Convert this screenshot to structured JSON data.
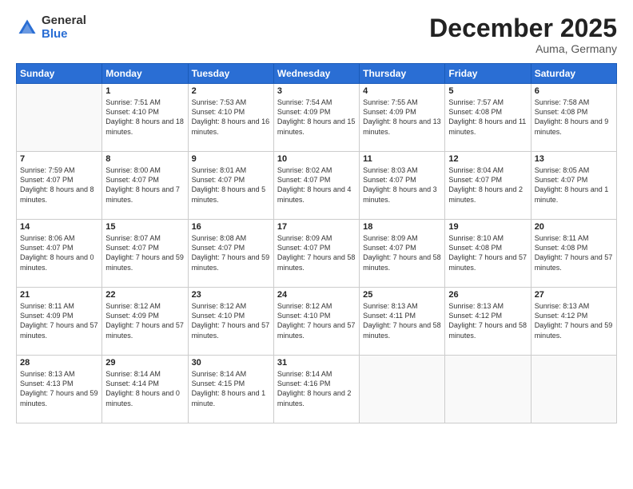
{
  "header": {
    "logo_general": "General",
    "logo_blue": "Blue",
    "month_title": "December 2025",
    "location": "Auma, Germany"
  },
  "days_of_week": [
    "Sunday",
    "Monday",
    "Tuesday",
    "Wednesday",
    "Thursday",
    "Friday",
    "Saturday"
  ],
  "weeks": [
    [
      {
        "day": "",
        "sunrise": "",
        "sunset": "",
        "daylight": "",
        "empty": true
      },
      {
        "day": "1",
        "sunrise": "Sunrise: 7:51 AM",
        "sunset": "Sunset: 4:10 PM",
        "daylight": "Daylight: 8 hours and 18 minutes."
      },
      {
        "day": "2",
        "sunrise": "Sunrise: 7:53 AM",
        "sunset": "Sunset: 4:10 PM",
        "daylight": "Daylight: 8 hours and 16 minutes."
      },
      {
        "day": "3",
        "sunrise": "Sunrise: 7:54 AM",
        "sunset": "Sunset: 4:09 PM",
        "daylight": "Daylight: 8 hours and 15 minutes."
      },
      {
        "day": "4",
        "sunrise": "Sunrise: 7:55 AM",
        "sunset": "Sunset: 4:09 PM",
        "daylight": "Daylight: 8 hours and 13 minutes."
      },
      {
        "day": "5",
        "sunrise": "Sunrise: 7:57 AM",
        "sunset": "Sunset: 4:08 PM",
        "daylight": "Daylight: 8 hours and 11 minutes."
      },
      {
        "day": "6",
        "sunrise": "Sunrise: 7:58 AM",
        "sunset": "Sunset: 4:08 PM",
        "daylight": "Daylight: 8 hours and 9 minutes."
      }
    ],
    [
      {
        "day": "7",
        "sunrise": "Sunrise: 7:59 AM",
        "sunset": "Sunset: 4:07 PM",
        "daylight": "Daylight: 8 hours and 8 minutes."
      },
      {
        "day": "8",
        "sunrise": "Sunrise: 8:00 AM",
        "sunset": "Sunset: 4:07 PM",
        "daylight": "Daylight: 8 hours and 7 minutes."
      },
      {
        "day": "9",
        "sunrise": "Sunrise: 8:01 AM",
        "sunset": "Sunset: 4:07 PM",
        "daylight": "Daylight: 8 hours and 5 minutes."
      },
      {
        "day": "10",
        "sunrise": "Sunrise: 8:02 AM",
        "sunset": "Sunset: 4:07 PM",
        "daylight": "Daylight: 8 hours and 4 minutes."
      },
      {
        "day": "11",
        "sunrise": "Sunrise: 8:03 AM",
        "sunset": "Sunset: 4:07 PM",
        "daylight": "Daylight: 8 hours and 3 minutes."
      },
      {
        "day": "12",
        "sunrise": "Sunrise: 8:04 AM",
        "sunset": "Sunset: 4:07 PM",
        "daylight": "Daylight: 8 hours and 2 minutes."
      },
      {
        "day": "13",
        "sunrise": "Sunrise: 8:05 AM",
        "sunset": "Sunset: 4:07 PM",
        "daylight": "Daylight: 8 hours and 1 minute."
      }
    ],
    [
      {
        "day": "14",
        "sunrise": "Sunrise: 8:06 AM",
        "sunset": "Sunset: 4:07 PM",
        "daylight": "Daylight: 8 hours and 0 minutes."
      },
      {
        "day": "15",
        "sunrise": "Sunrise: 8:07 AM",
        "sunset": "Sunset: 4:07 PM",
        "daylight": "Daylight: 7 hours and 59 minutes."
      },
      {
        "day": "16",
        "sunrise": "Sunrise: 8:08 AM",
        "sunset": "Sunset: 4:07 PM",
        "daylight": "Daylight: 7 hours and 59 minutes."
      },
      {
        "day": "17",
        "sunrise": "Sunrise: 8:09 AM",
        "sunset": "Sunset: 4:07 PM",
        "daylight": "Daylight: 7 hours and 58 minutes."
      },
      {
        "day": "18",
        "sunrise": "Sunrise: 8:09 AM",
        "sunset": "Sunset: 4:07 PM",
        "daylight": "Daylight: 7 hours and 58 minutes."
      },
      {
        "day": "19",
        "sunrise": "Sunrise: 8:10 AM",
        "sunset": "Sunset: 4:08 PM",
        "daylight": "Daylight: 7 hours and 57 minutes."
      },
      {
        "day": "20",
        "sunrise": "Sunrise: 8:11 AM",
        "sunset": "Sunset: 4:08 PM",
        "daylight": "Daylight: 7 hours and 57 minutes."
      }
    ],
    [
      {
        "day": "21",
        "sunrise": "Sunrise: 8:11 AM",
        "sunset": "Sunset: 4:09 PM",
        "daylight": "Daylight: 7 hours and 57 minutes."
      },
      {
        "day": "22",
        "sunrise": "Sunrise: 8:12 AM",
        "sunset": "Sunset: 4:09 PM",
        "daylight": "Daylight: 7 hours and 57 minutes."
      },
      {
        "day": "23",
        "sunrise": "Sunrise: 8:12 AM",
        "sunset": "Sunset: 4:10 PM",
        "daylight": "Daylight: 7 hours and 57 minutes."
      },
      {
        "day": "24",
        "sunrise": "Sunrise: 8:12 AM",
        "sunset": "Sunset: 4:10 PM",
        "daylight": "Daylight: 7 hours and 57 minutes."
      },
      {
        "day": "25",
        "sunrise": "Sunrise: 8:13 AM",
        "sunset": "Sunset: 4:11 PM",
        "daylight": "Daylight: 7 hours and 58 minutes."
      },
      {
        "day": "26",
        "sunrise": "Sunrise: 8:13 AM",
        "sunset": "Sunset: 4:12 PM",
        "daylight": "Daylight: 7 hours and 58 minutes."
      },
      {
        "day": "27",
        "sunrise": "Sunrise: 8:13 AM",
        "sunset": "Sunset: 4:12 PM",
        "daylight": "Daylight: 7 hours and 59 minutes."
      }
    ],
    [
      {
        "day": "28",
        "sunrise": "Sunrise: 8:13 AM",
        "sunset": "Sunset: 4:13 PM",
        "daylight": "Daylight: 7 hours and 59 minutes."
      },
      {
        "day": "29",
        "sunrise": "Sunrise: 8:14 AM",
        "sunset": "Sunset: 4:14 PM",
        "daylight": "Daylight: 8 hours and 0 minutes."
      },
      {
        "day": "30",
        "sunrise": "Sunrise: 8:14 AM",
        "sunset": "Sunset: 4:15 PM",
        "daylight": "Daylight: 8 hours and 1 minute."
      },
      {
        "day": "31",
        "sunrise": "Sunrise: 8:14 AM",
        "sunset": "Sunset: 4:16 PM",
        "daylight": "Daylight: 8 hours and 2 minutes."
      },
      {
        "day": "",
        "sunrise": "",
        "sunset": "",
        "daylight": "",
        "empty": true
      },
      {
        "day": "",
        "sunrise": "",
        "sunset": "",
        "daylight": "",
        "empty": true
      },
      {
        "day": "",
        "sunrise": "",
        "sunset": "",
        "daylight": "",
        "empty": true
      }
    ]
  ]
}
